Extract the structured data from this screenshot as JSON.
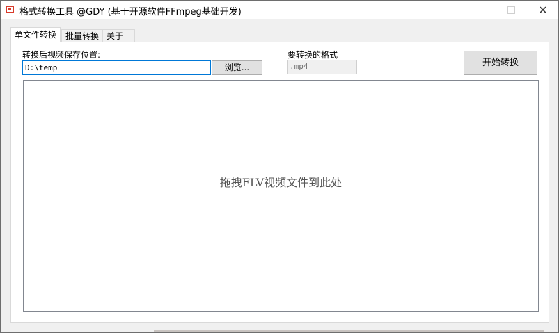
{
  "window": {
    "title": "格式转换工具 @GDY (基于开源软件FFmpeg基础开发)",
    "controls": {
      "minimize": "—",
      "maximize": "☐",
      "close": "✕"
    }
  },
  "tabs": [
    {
      "label": "单文件转换",
      "active": true
    },
    {
      "label": "批量转换",
      "active": false
    },
    {
      "label": "关于",
      "active": false
    }
  ],
  "single": {
    "save_label": "转换后视频保存位置:",
    "save_path": "D:\\temp",
    "browse_label": "浏览...",
    "format_label": "要转换的格式",
    "format_value": ".mp4",
    "start_label": "开始转换",
    "drop_hint": "拖拽FLV视频文件到此处"
  },
  "icons": {
    "app": "app-icon",
    "minimize": "minimize-icon",
    "maximize": "maximize-icon",
    "close": "close-icon"
  },
  "colors": {
    "accent_border": "#0078d7",
    "app_icon": "#d83b2b"
  }
}
